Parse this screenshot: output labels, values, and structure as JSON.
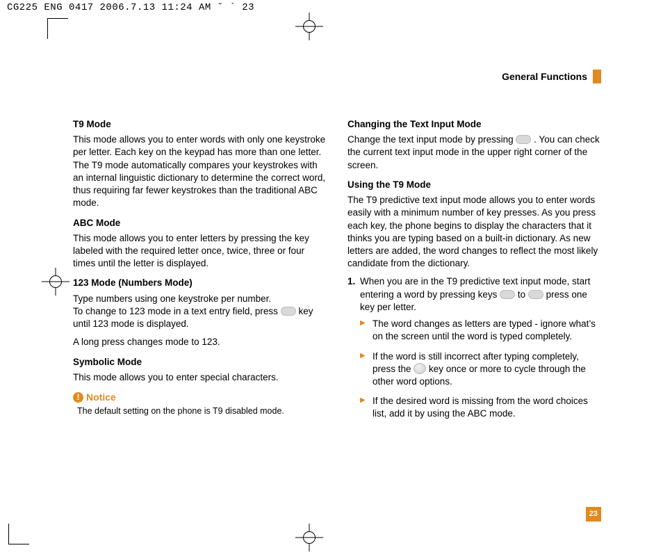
{
  "meta": {
    "header_line": "CG225 ENG 0417  2006.7.13 11:24 AM  ˘  ` 23"
  },
  "header": {
    "title": "General Functions"
  },
  "page_number": "23",
  "left": {
    "t9_h": "T9 Mode",
    "t9_p": "This mode allows you to enter words with only one keystroke per letter. Each key on the keypad has more than one letter. The T9 mode automatically compares your keystrokes with an internal linguistic dictionary to determine the correct word, thus requiring far fewer keystrokes than the traditional ABC mode.",
    "abc_h": "ABC Mode",
    "abc_p": "This mode allows you to enter letters by pressing the key labeled with the required letter once, twice, three or four times until the letter is displayed.",
    "n123_h": "123 Mode (Numbers Mode)",
    "n123_p1a": "Type numbers using one keystroke per number.",
    "n123_p1b": "To change to 123 mode in a text entry field, press ",
    "n123_p1c": " key until 123 mode is displayed.",
    "n123_p2": "A long press changes mode to 123.",
    "sym_h": "Symbolic Mode",
    "sym_p": "This mode allows you to enter special characters.",
    "notice_label": "Notice",
    "notice_body": "The default setting on the phone is T9 disabled mode."
  },
  "right": {
    "chg_h": "Changing the Text Input Mode",
    "chg_p_a": "Change the text input mode by pressing ",
    "chg_p_b": " . You can check the current text input mode in the upper right corner of the screen.",
    "use_h": "Using the T9 Mode",
    "use_p": "The T9 predictive text input mode allows you to enter words easily with a minimum number of key presses. As you press each key, the phone begins to display the characters that it thinks you are typing based on a built-in dictionary. As new letters are added, the word changes to reflect the most likely candidate from the dictionary.",
    "step1_num": "1.",
    "step1_a": "When you are in the T9 predictive text input mode, start entering a word by pressing keys ",
    "step1_b": " to ",
    "step1_c": " press one key per letter.",
    "b1": "The word changes as letters are typed - ignore what’s on the screen until the word is typed completely.",
    "b2_a": "If the word is still incorrect after typing completely, press the ",
    "b2_b": " key once or more to cycle through the other word options.",
    "b3": "If the desired word is missing from the word choices list, add it by using the ABC mode."
  }
}
